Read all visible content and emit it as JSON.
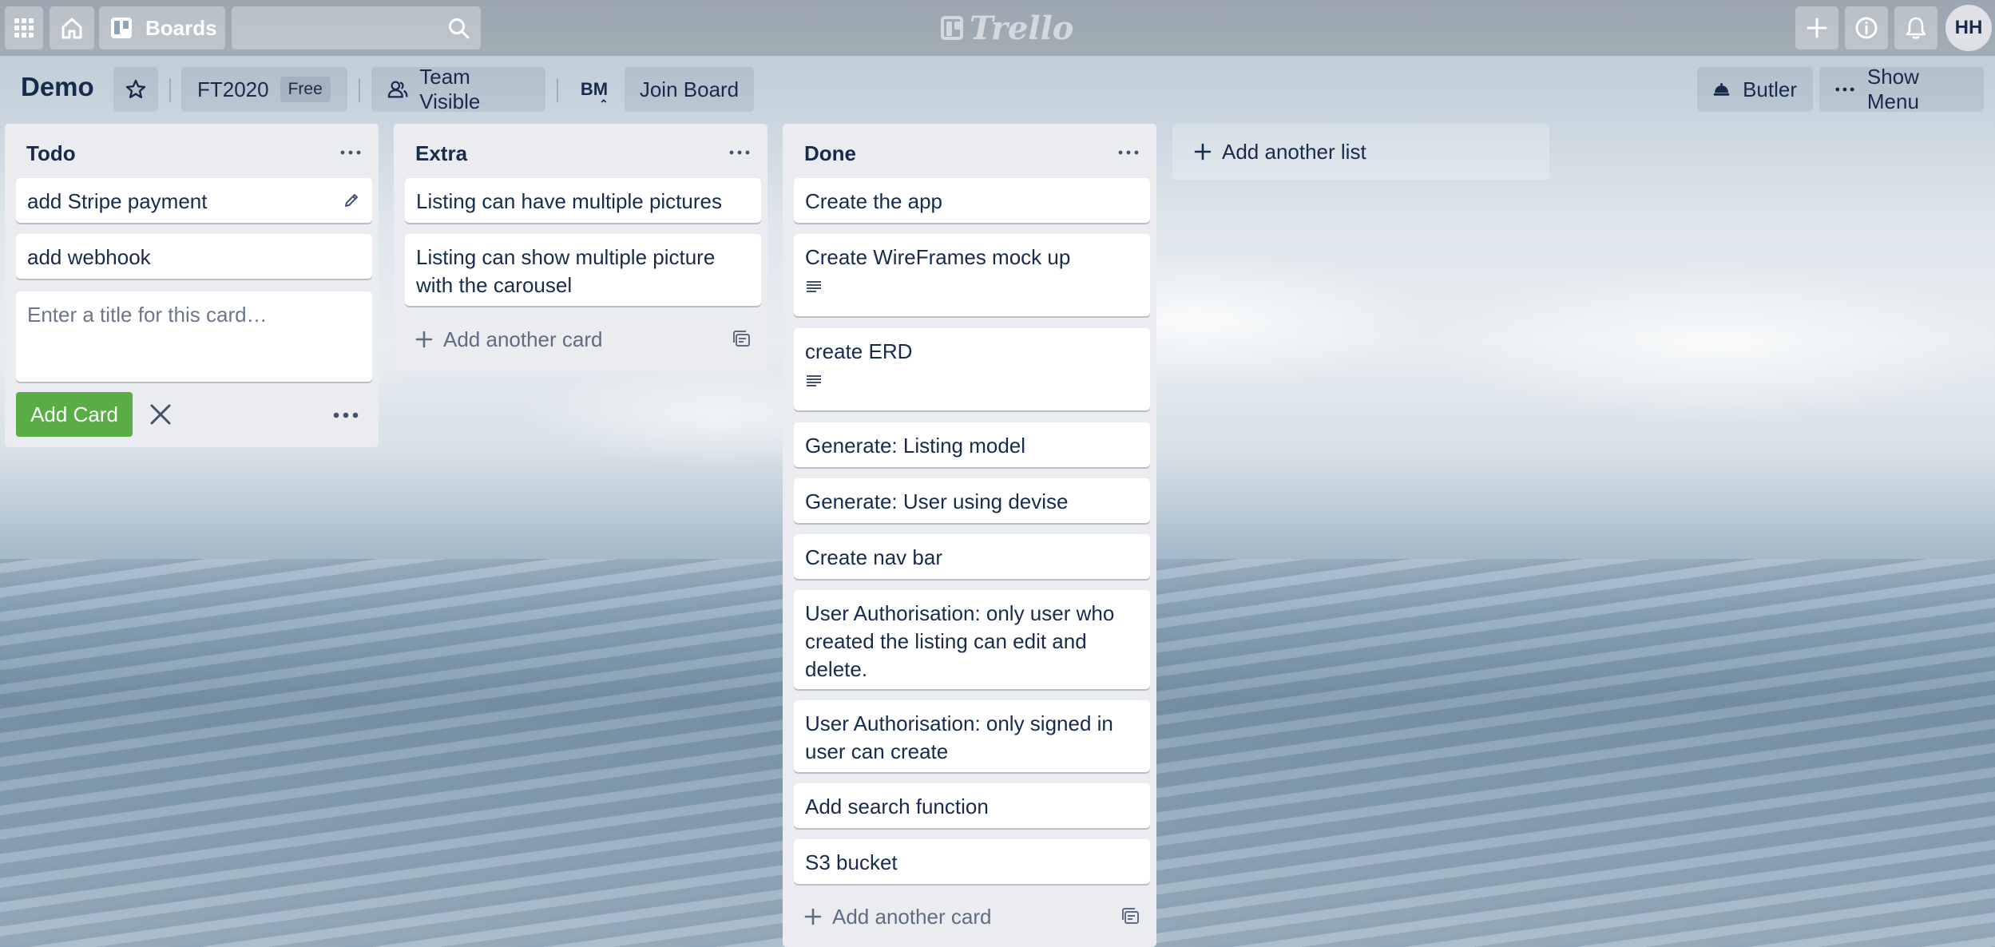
{
  "header": {
    "boards_label": "Boards",
    "search_value": "",
    "logo_text": "Trello",
    "avatar_initials": "HH"
  },
  "board": {
    "title": "Demo",
    "team_name": "FT2020",
    "team_plan": "Free",
    "visibility_label": "Team Visible",
    "member_initials": "BM",
    "join_label": "Join Board",
    "butler_label": "Butler",
    "show_menu_label": "Show Menu"
  },
  "lists": [
    {
      "title": "Todo",
      "cards": [
        {
          "title": "add Stripe payment"
        },
        {
          "title": "add webhook"
        }
      ],
      "composer": {
        "placeholder": "Enter a title for this card…",
        "add_label": "Add Card"
      }
    },
    {
      "title": "Extra",
      "cards": [
        {
          "title": "Listing can have multiple pictures"
        },
        {
          "title": "Listing can show multiple picture with the carousel"
        }
      ],
      "add_card_label": "Add another card"
    },
    {
      "title": "Done",
      "cards": [
        {
          "title": "Create the app"
        },
        {
          "title": "Create WireFrames mock up",
          "has_description": true
        },
        {
          "title": "create ERD",
          "has_description": true
        },
        {
          "title": "Generate: Listing model"
        },
        {
          "title": "Generate: User using devise"
        },
        {
          "title": "Create nav bar"
        },
        {
          "title": "User Authorisation: only user who created the listing can edit and delete."
        },
        {
          "title": "User Authorisation: only signed in user can create"
        },
        {
          "title": "Add search function"
        },
        {
          "title": "S3 bucket"
        }
      ],
      "add_card_label": "Add another card"
    }
  ],
  "add_list_label": "Add another list",
  "icons": {
    "apps": "grid-icon",
    "home": "home-icon",
    "boards": "board-icon",
    "search": "search-icon",
    "create": "plus-icon",
    "info": "info-icon",
    "notifications": "bell-icon",
    "star": "star-icon",
    "visibility": "team-icon",
    "butler": "butler-icon",
    "menu": "ellipsis-icon"
  }
}
